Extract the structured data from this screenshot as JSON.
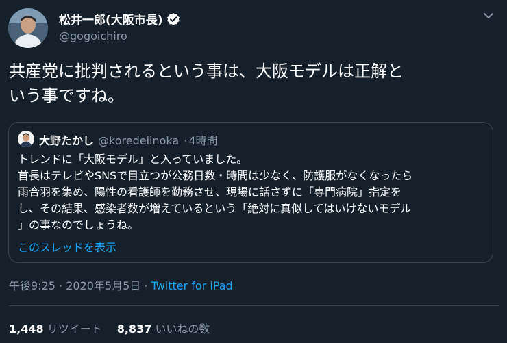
{
  "tweet": {
    "author_name": "松井一郎(大阪市長)",
    "author_handle": "@gogoichiro",
    "text_line1": "共産党に批判されるという事は、大阪モデルは正解と",
    "text_line2": "いう事ですね。",
    "timestamp": "午後9:25 · 2020年5月5日",
    "meta_separator": "·",
    "source": "Twitter for iPad",
    "retweets_count": "1,448",
    "retweets_label": "リツイート",
    "likes_count": "8,837",
    "likes_label": "いいねの数"
  },
  "quote": {
    "author_name": "大野たかし",
    "author_handle": "@koredeiinoka",
    "separator": "·",
    "time": "4時間",
    "lines": [
      "トレンドに「大阪モデル」と入っていました。",
      "首長はテレビやSNSで目立つが公務日数・時間は少なく、防護服がなくなったら",
      "雨合羽を集め、陽性の看護師を勤務させ、現場に話さずに「専門病院」指定を",
      "し、その結果、感染者数が増えているという「絶対に真似してはいけないモデル",
      "」の事なのでしょうね。"
    ],
    "thread_link": "このスレッドを表示"
  },
  "icons": {
    "verified": "verified-badge-icon",
    "more": "chevron-down-icon"
  },
  "colors": {
    "background": "#15202b",
    "link": "#1da1f2",
    "secondary_text": "#8899a6",
    "border": "#38444d"
  }
}
